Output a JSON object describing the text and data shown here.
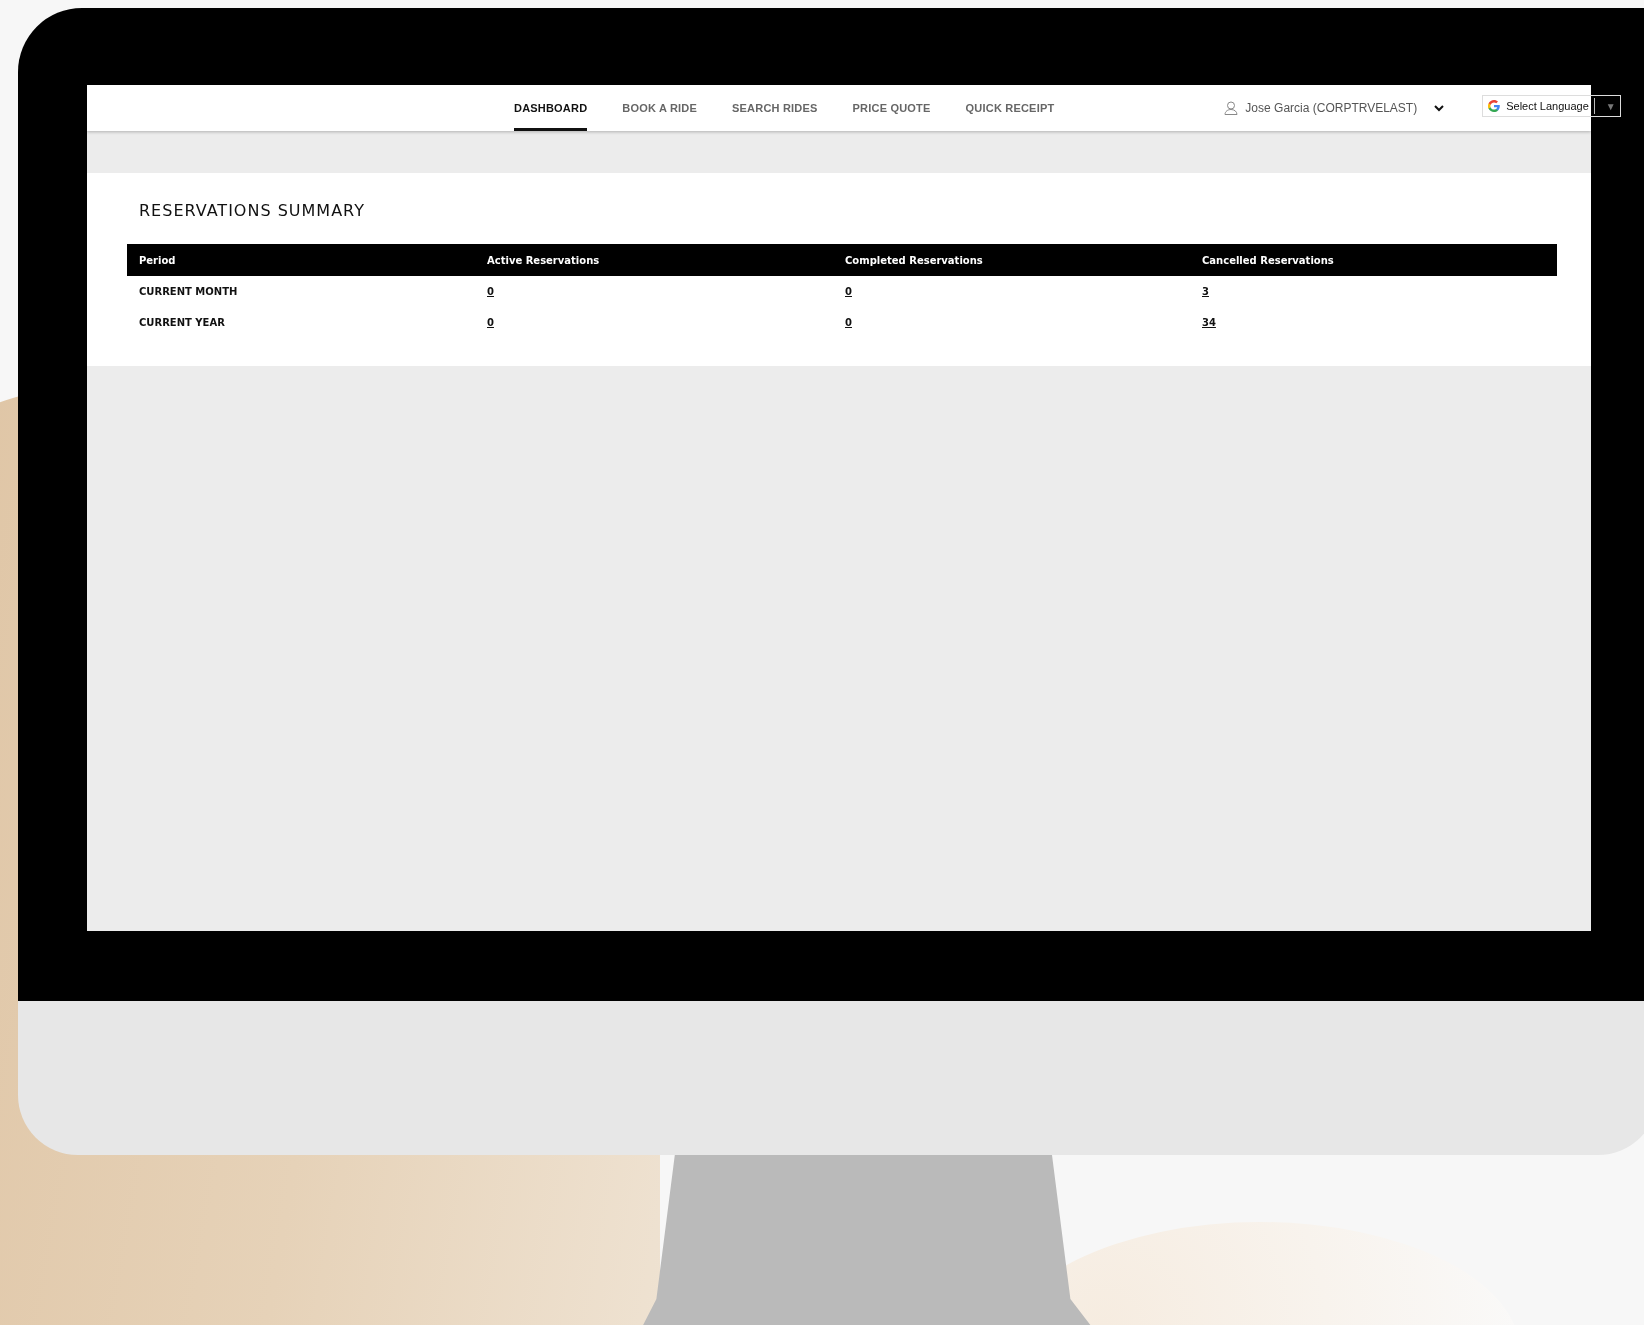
{
  "nav": {
    "tabs": [
      {
        "label": "DASHBOARD",
        "selected": true
      },
      {
        "label": "BOOK A RIDE",
        "selected": false
      },
      {
        "label": "SEARCH RIDES",
        "selected": false
      },
      {
        "label": "PRICE QUOTE",
        "selected": false
      },
      {
        "label": "QUICK RECEIPT",
        "selected": false
      }
    ],
    "user": {
      "name": "Jose Garcia (CORPTRVELAST)"
    },
    "language": {
      "label": "Select Language",
      "arrow": "▼"
    }
  },
  "summary": {
    "title": "RESERVATIONS SUMMARY",
    "columns": [
      "Period",
      "Active Reservations",
      "Completed Reservations",
      "Cancelled Reservations"
    ],
    "rows": [
      {
        "period": "CURRENT MONTH",
        "values": [
          "0",
          "0",
          "3"
        ]
      },
      {
        "period": "CURRENT YEAR",
        "values": [
          "0",
          "0",
          "34"
        ]
      }
    ]
  }
}
